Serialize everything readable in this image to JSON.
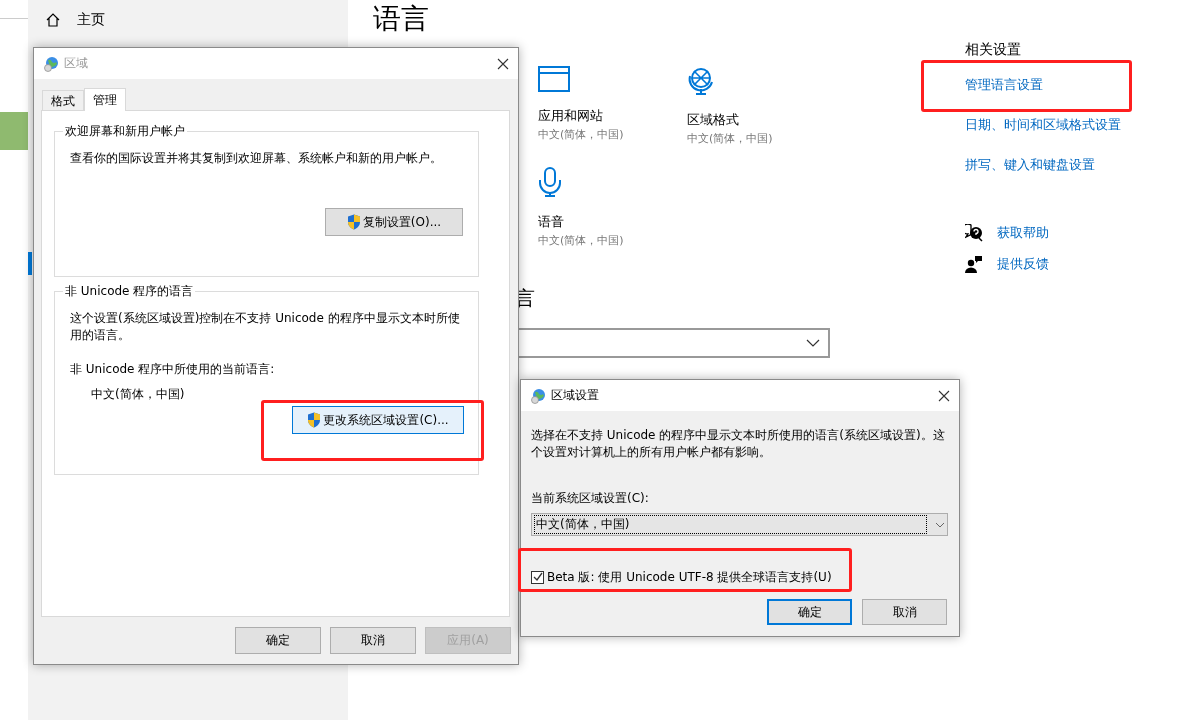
{
  "settings_window": {
    "sidebar": {
      "home_label": "主页"
    },
    "title": "语言",
    "tiles": [
      {
        "kind": "window",
        "label": "应用和网站",
        "value": "中文(简体，中国)"
      },
      {
        "kind": "globe",
        "label": "区域格式",
        "value": "中文(简体，中国)"
      },
      {
        "kind": "microphone",
        "label": "语音",
        "value": "中文(简体，中国)"
      }
    ],
    "section_heading": "言",
    "dropdown": {
      "kind": "combo"
    },
    "related": {
      "heading": "相关设置",
      "links": [
        {
          "label": "管理语言设置",
          "highlighted": true
        },
        {
          "label": "日期、时间和区域格式设置",
          "highlighted": false
        },
        {
          "label": "拼写、键入和键盘设置",
          "highlighted": false
        }
      ]
    },
    "help_links": [
      {
        "kind": "help",
        "label": "获取帮助"
      },
      {
        "kind": "feedback",
        "label": "提供反馈"
      }
    ]
  },
  "region_dialog": {
    "title": "区域",
    "tabs": [
      {
        "label": "格式",
        "selected": false
      },
      {
        "label": "管理",
        "selected": true
      }
    ],
    "groups": [
      {
        "legend": "欢迎屏幕和新用户帐户",
        "text": "查看你的国际设置并将其复制到欢迎屏幕、系统帐户和新的用户帐户。",
        "button": {
          "label": "复制设置(O)...",
          "highlighted": false,
          "focused": false
        }
      },
      {
        "legend": "非 Unicode 程序的语言",
        "text": "这个设置(系统区域设置)控制在不支持 Unicode 的程序中显示文本时所使用的语言。",
        "current_label": "非 Unicode 程序中所使用的当前语言:",
        "current_value": "中文(简体，中国)",
        "button": {
          "label": "更改系统区域设置(C)...",
          "highlighted": true,
          "focused": true
        }
      }
    ],
    "buttons": [
      {
        "label": "确定",
        "disabled": false
      },
      {
        "label": "取消",
        "disabled": false
      },
      {
        "label": "应用(A)",
        "disabled": true
      }
    ]
  },
  "locale_dialog": {
    "title": "区域设置",
    "text": "选择在不支持 Unicode 的程序中显示文本时所使用的语言(系统区域设置)。这个设置对计算机上的所有用户帐户都有影响。",
    "select_label": "当前系统区域设置(C):",
    "select_value": "中文(简体，中国)",
    "checkbox": {
      "label": "Beta 版: 使用 Unicode UTF-8 提供全球语言支持(U)",
      "checked": true,
      "highlighted": true
    },
    "buttons": [
      {
        "label": "确定",
        "default": true
      },
      {
        "label": "取消",
        "default": false
      }
    ]
  }
}
